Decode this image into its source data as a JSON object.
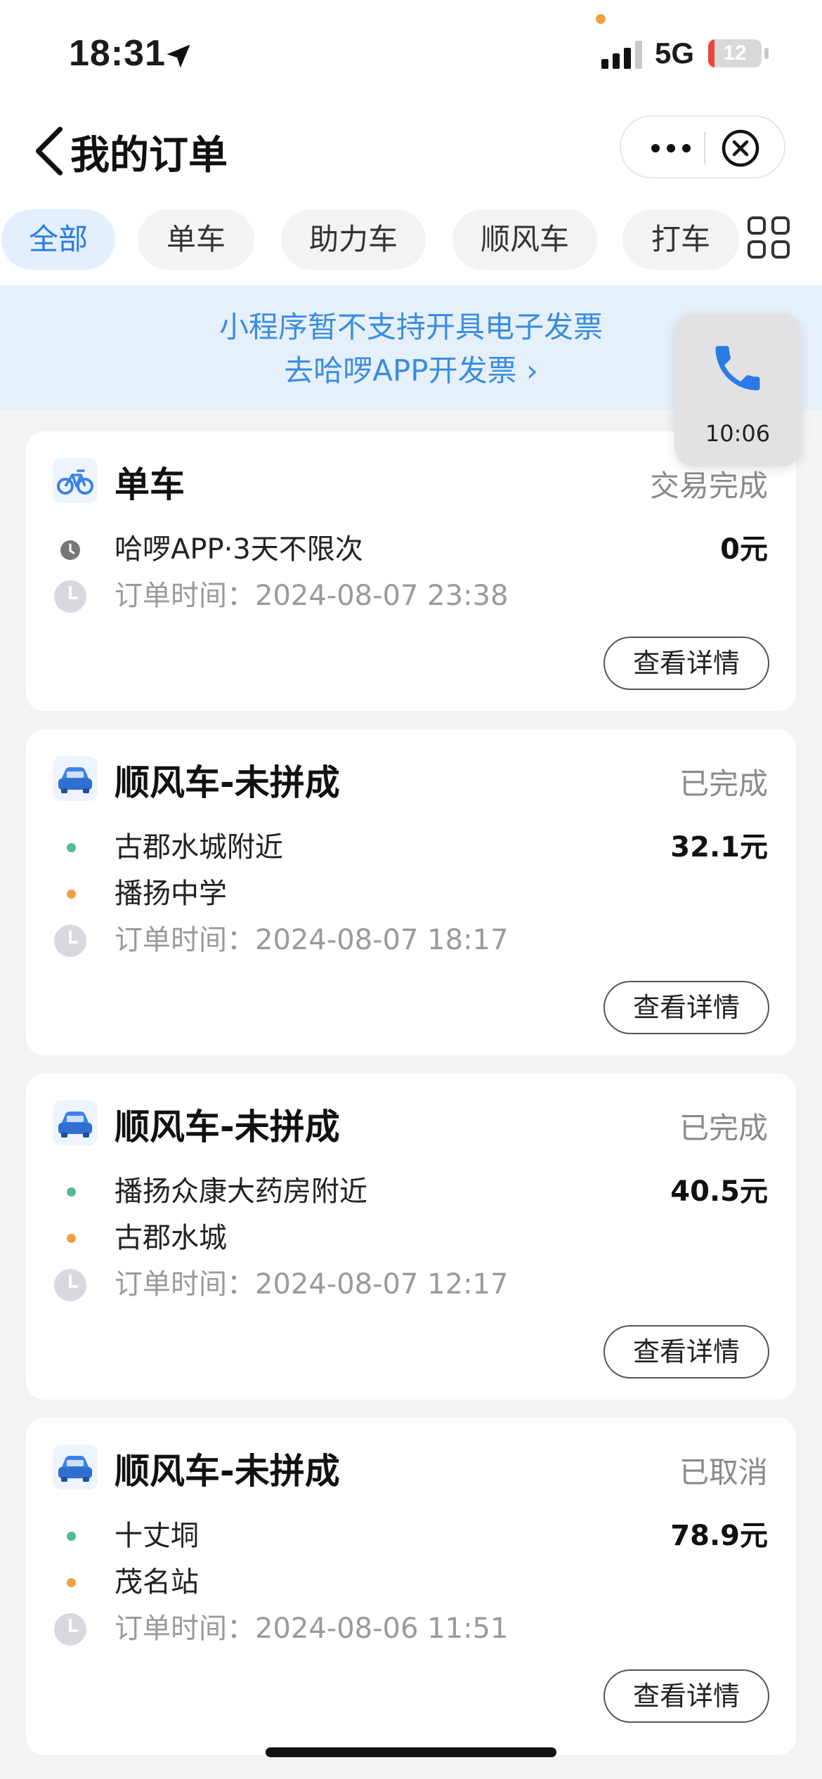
{
  "status_bar": {
    "time": "18:31",
    "network": "5G",
    "battery": "12",
    "battery_level": 0.12
  },
  "nav": {
    "title": "我的订单"
  },
  "tabs": [
    {
      "label": "全部",
      "active": true
    },
    {
      "label": "单车",
      "active": false
    },
    {
      "label": "助力车",
      "active": false
    },
    {
      "label": "顺风车",
      "active": false
    },
    {
      "label": "打车",
      "active": false
    }
  ],
  "invoice_banner": {
    "line1": "小程序暂不支持开具电子发票",
    "line2": "去哈啰APP开发票 ›"
  },
  "call_widget": {
    "time": "10:06"
  },
  "orders": [
    {
      "icon": "bicycle-icon",
      "title": "单车",
      "status": "交易完成",
      "item": "哈啰APP·3天不限次",
      "price": "0元",
      "time": "订单时间：2024-08-07 23:38",
      "detail_label": "查看详情"
    },
    {
      "icon": "car-icon",
      "title": "顺风车-未拼成",
      "status": "已完成",
      "from": "古郡水城附近",
      "to": "播扬中学",
      "price": "32.1元",
      "time": "订单时间：2024-08-07 18:17",
      "detail_label": "查看详情"
    },
    {
      "icon": "car-icon",
      "title": "顺风车-未拼成",
      "status": "已完成",
      "from": "播扬众康大药房附近",
      "to": "古郡水城",
      "price": "40.5元",
      "time": "订单时间：2024-08-07 12:17",
      "detail_label": "查看详情"
    },
    {
      "icon": "car-icon",
      "title": "顺风车-未拼成",
      "status": "已取消",
      "from": "十丈垌",
      "to": "茂名站",
      "price": "78.9元",
      "time": "订单时间：2024-08-06 11:51",
      "detail_label": "查看详情"
    }
  ],
  "colors": {
    "accent": "#2a7be4",
    "banner_text": "#3a8de0",
    "from_dot": "#54b89c",
    "to_dot": "#eba145"
  }
}
